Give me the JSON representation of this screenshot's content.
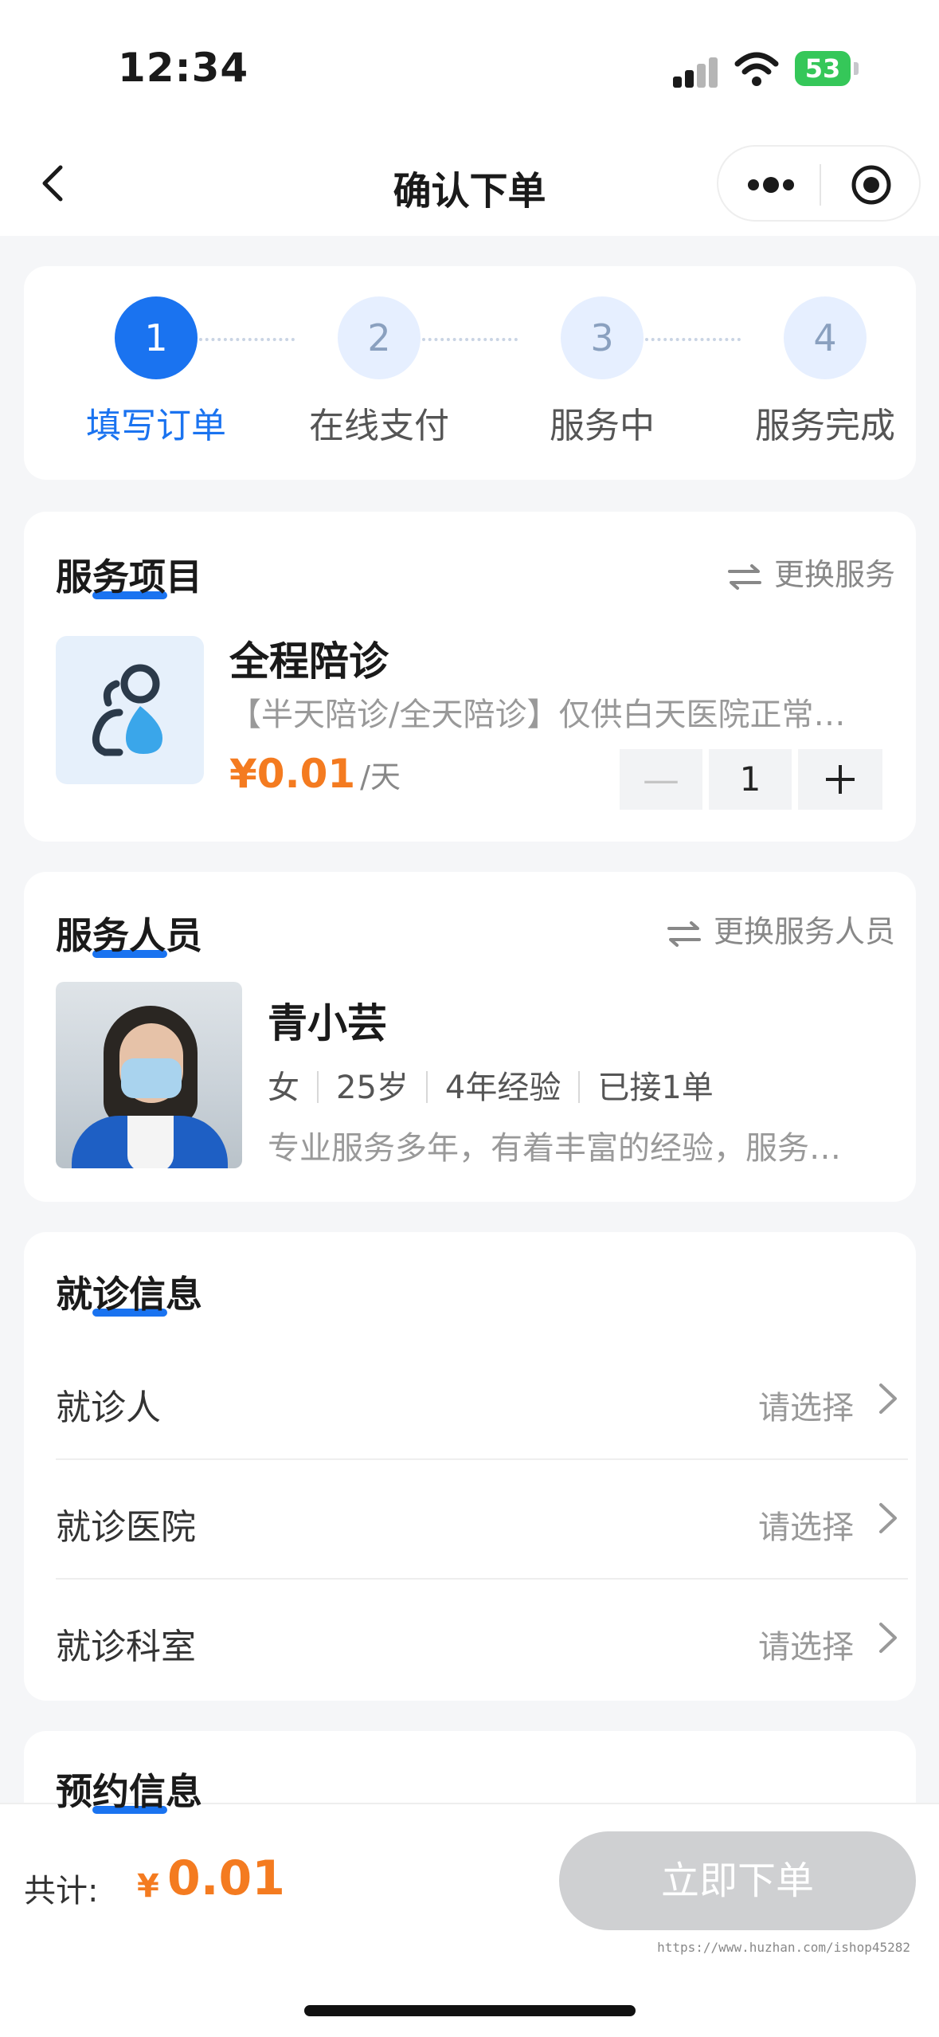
{
  "status_bar": {
    "time": "12:34",
    "battery": "53"
  },
  "nav": {
    "title": "确认下单"
  },
  "steps": [
    {
      "num": "1",
      "label": "填写订单"
    },
    {
      "num": "2",
      "label": "在线支付"
    },
    {
      "num": "3",
      "label": "服务中"
    },
    {
      "num": "4",
      "label": "服务完成"
    }
  ],
  "service": {
    "title": "服务项目",
    "change": "更换服务",
    "name": "全程陪诊",
    "desc": "【半天陪诊/全天陪诊】仅供白天医院正常…",
    "price": "¥0.01",
    "unit": "/天",
    "quantity": "1"
  },
  "staff": {
    "title": "服务人员",
    "change": "更换服务人员",
    "name": "青小芸",
    "tags": [
      "女",
      "25岁",
      "4年经验",
      "已接1单"
    ],
    "desc": "专业服务多年，有着丰富的经验，服务…"
  },
  "visit": {
    "title": "就诊信息",
    "rows": [
      {
        "label": "就诊人",
        "value": "请选择"
      },
      {
        "label": "就诊医院",
        "value": "请选择"
      },
      {
        "label": "就诊科室",
        "value": "请选择"
      }
    ]
  },
  "booking": {
    "title": "预约信息"
  },
  "footer": {
    "total_label": "共计:",
    "currency": "¥",
    "total": "0.01",
    "button": "立即下单",
    "watermark": "https://www.huzhan.com/ishop45282"
  },
  "colors": {
    "accent": "#1a73f0",
    "price": "#f47b20",
    "disabled_button": "#cfd0d2"
  }
}
